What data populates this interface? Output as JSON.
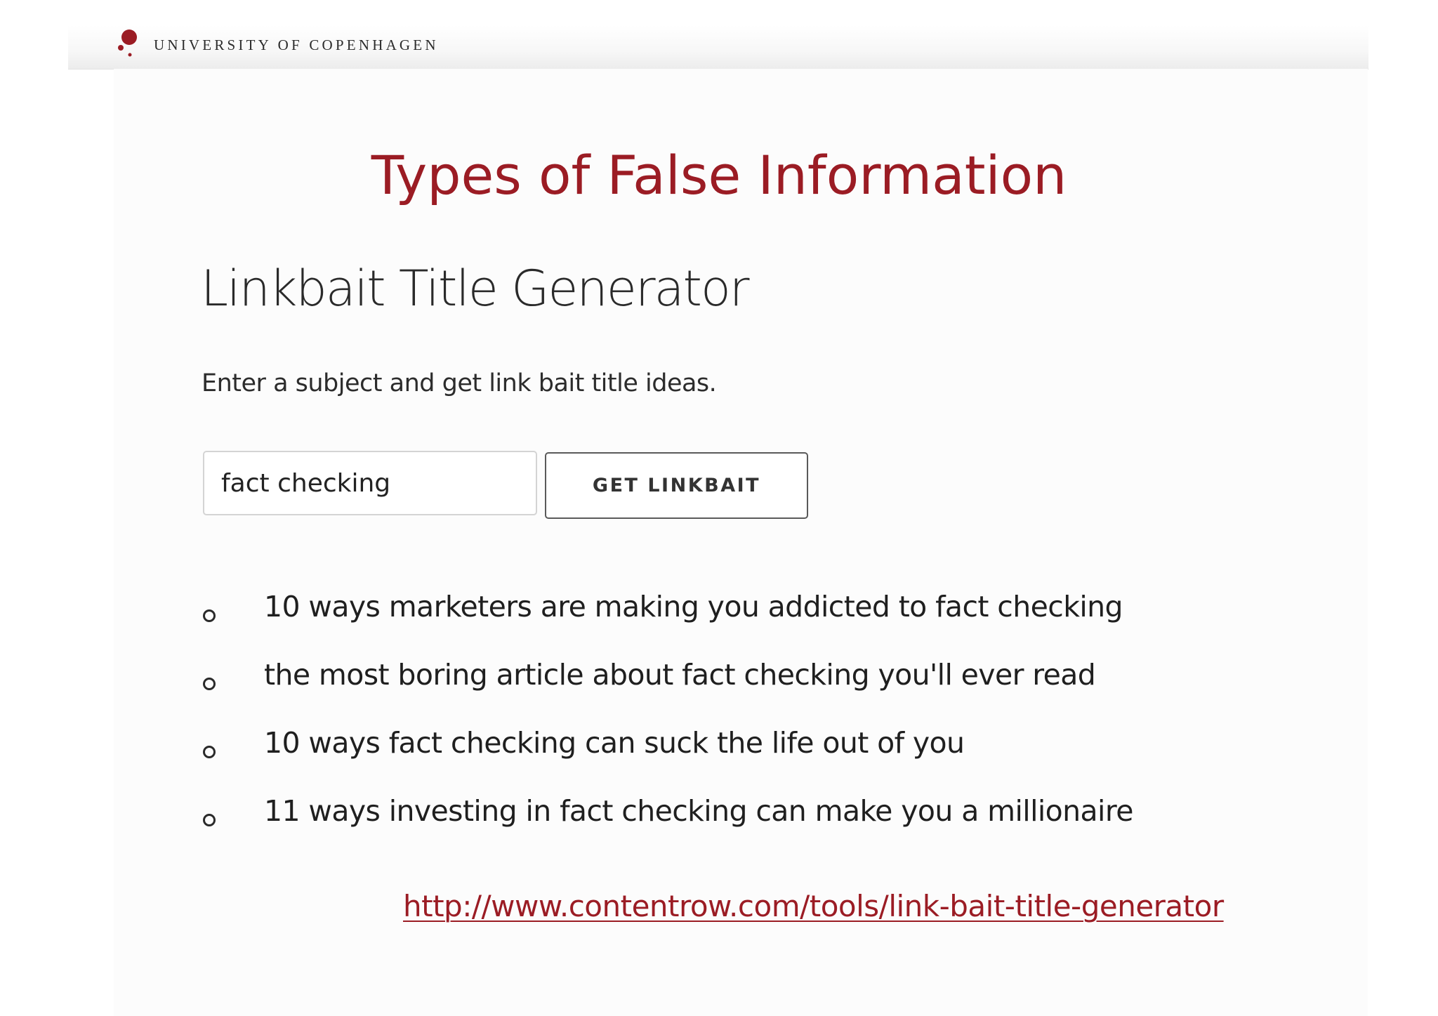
{
  "header": {
    "institution": "UNIVERSITY OF COPENHAGEN",
    "logo_icon": "ku-seal-dots-icon",
    "brand_color": "#9b1c24"
  },
  "slide": {
    "title": "Types of False Information",
    "title_color": "#9b1c24"
  },
  "tool": {
    "heading": "Linkbait Title Generator",
    "subtitle": "Enter a subject and get link bait title ideas.",
    "input_value": "fact checking",
    "button_label": "GET LINKBAIT",
    "results": [
      "10 ways marketers are making you addicted to fact checking",
      "the most boring article about fact checking you'll ever read",
      "10 ways fact checking can suck the life out of you",
      "11 ways investing in fact checking can make you a millionaire"
    ],
    "bullet_icon": "hollow-circle-bullet-icon"
  },
  "source": {
    "link_text": "http://www.contentrow.com/tools/link-bait-title-generator"
  }
}
